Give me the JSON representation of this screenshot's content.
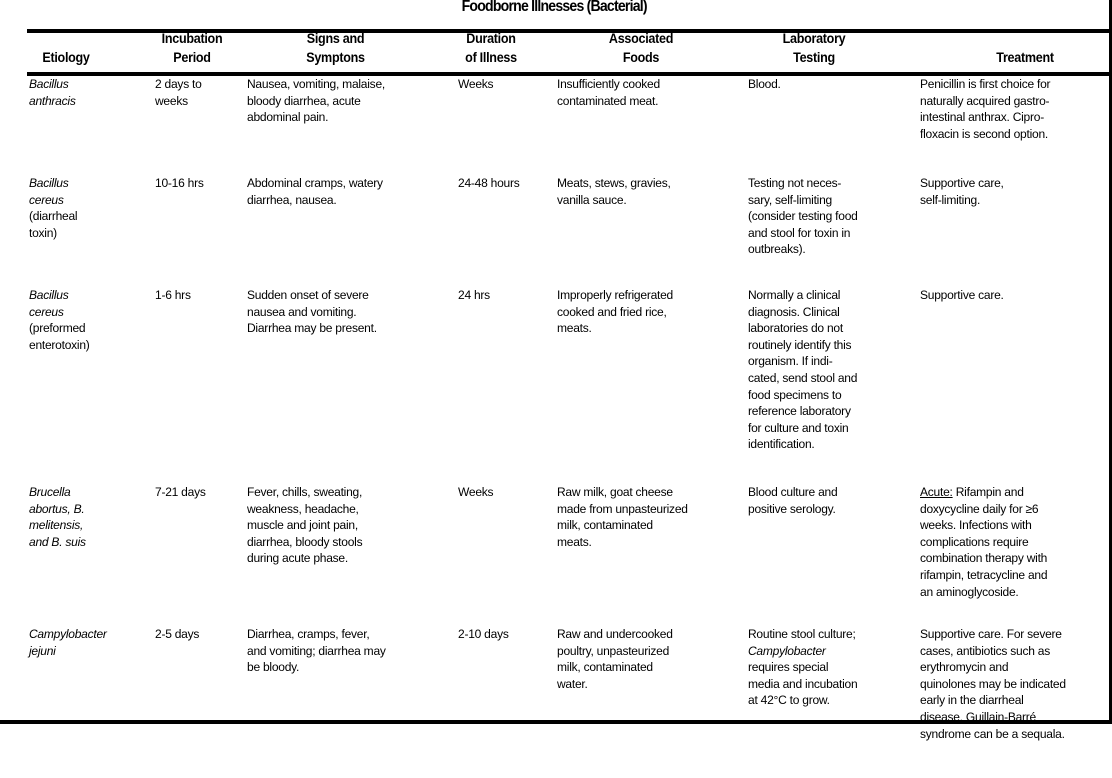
{
  "title": "Foodborne Illnesses (Bacterial)",
  "columns": [
    {
      "id": "etiology",
      "line1": "",
      "line2": "Etiology"
    },
    {
      "id": "incubation",
      "line1": "Incubation",
      "line2": "Period"
    },
    {
      "id": "signs",
      "line1": "Signs and",
      "line2": "Symptons"
    },
    {
      "id": "duration",
      "line1": "Duration",
      "line2": "of Illness"
    },
    {
      "id": "foods",
      "line1": "Associated",
      "line2": "Foods"
    },
    {
      "id": "lab",
      "line1": "Laboratory",
      "line2": "Testing"
    },
    {
      "id": "treatment",
      "line1": "",
      "line2": "Treatment"
    }
  ],
  "rows": [
    {
      "etiology_italic": "Bacillus\nanthracis",
      "etiology_roman": "",
      "incubation": "2 days to\nweeks",
      "signs": "Nausea, vomiting, malaise,\nbloody diarrhea, acute\nabdominal pain.",
      "duration": "Weeks",
      "foods": "Insufficiently cooked\ncontaminated meat.",
      "lab": "Blood.",
      "treatment": "Penicillin is first choice for\nnaturally acquired gastro-\nintestinal anthrax. Cipro-\nfloxacin is second option."
    },
    {
      "etiology_italic": "Bacillus\ncereus",
      "etiology_roman": "(diarrheal\ntoxin)",
      "incubation": "10-16 hrs",
      "signs": "Abdominal cramps, watery\ndiarrhea, nausea.",
      "duration": "24-48 hours",
      "foods": "Meats, stews, gravies,\nvanilla sauce.",
      "lab": "Testing not neces-\nsary, self-limiting\n(consider testing food\nand stool for toxin in\noutbreaks).",
      "treatment": "Supportive care,\nself-limiting."
    },
    {
      "etiology_italic": "Bacillus\ncereus",
      "etiology_roman": "(preformed\nenterotoxin)",
      "incubation": "1-6 hrs",
      "signs": "Sudden onset of severe\nnausea and vomiting.\nDiarrhea may be present.",
      "duration": "24 hrs",
      "foods": "Improperly refrigerated\ncooked and fried rice,\nmeats.",
      "lab": "Normally a clinical\ndiagnosis. Clinical\nlaboratories do not\nroutinely identify this\norganism. If indi-\ncated, send stool and\nfood specimens to\nreference laboratory\nfor culture and toxin\nidentification.",
      "treatment": "Supportive care."
    },
    {
      "etiology_italic": "Brucella",
      "etiology_roman": "",
      "etiology_mixed": true,
      "etiology_lines": [
        [
          {
            "t": "Brucella",
            "i": true
          }
        ],
        [
          {
            "t": "abortus, ",
            "i": true
          },
          {
            "t": "B.",
            "i": true
          }
        ],
        [
          {
            "t": "melitensis",
            "i": true
          },
          {
            "t": ",",
            "i": false
          }
        ],
        [
          {
            "t": "and ",
            "i": false
          },
          {
            "t": "B. suis",
            "i": true
          }
        ]
      ],
      "incubation": "7-21 days",
      "signs": "Fever, chills, sweating,\nweakness, headache,\nmuscle and joint pain,\ndiarrhea, bloody stools\nduring acute phase.",
      "duration": "Weeks",
      "foods": "Raw milk, goat cheese\nmade from unpasteurized\nmilk, contaminated\nmeats.",
      "lab": "Blood culture and\npositive serology.",
      "treatment_prefix": "Acute:",
      "treatment": " Rifampin and\ndoxycycline daily for ≥6\nweeks. Infections with\ncomplications require\ncombination therapy with\nrifampin, tetracycline and\nan aminoglycoside."
    },
    {
      "etiology_italic": "Campylobacter\njejuni",
      "etiology_roman": "",
      "incubation": "2-5 days",
      "signs": "Diarrhea, cramps, fever,\nand vomiting; diarrhea may\nbe bloody.",
      "duration": "2-10 days",
      "foods": "Raw and undercooked\npoultry, unpasteurized\nmilk, contaminated\nwater.",
      "lab_lines": [
        [
          {
            "t": "Routine stool culture;",
            "i": false
          }
        ],
        [
          {
            "t": "Campylobacter",
            "i": true
          }
        ],
        [
          {
            "t": "requires special",
            "i": false
          }
        ],
        [
          {
            "t": "media and incubation",
            "i": false
          }
        ],
        [
          {
            "t": "at 42°C to grow.",
            "i": false
          }
        ]
      ],
      "lab": "Routine stool culture;\nCampylobacter\nrequires special\nmedia and incubation\nat 42°C to grow.",
      "treatment": "Supportive care. For severe\ncases, antibiotics such as\nerythromycin and\nquinolones may be indicated\nearly in the diarrheal\ndisease. Guillain-Barré\nsyndrome can be a sequala."
    }
  ],
  "colors": {
    "text": "#000000",
    "rule": "#000000",
    "background": "#ffffff"
  }
}
